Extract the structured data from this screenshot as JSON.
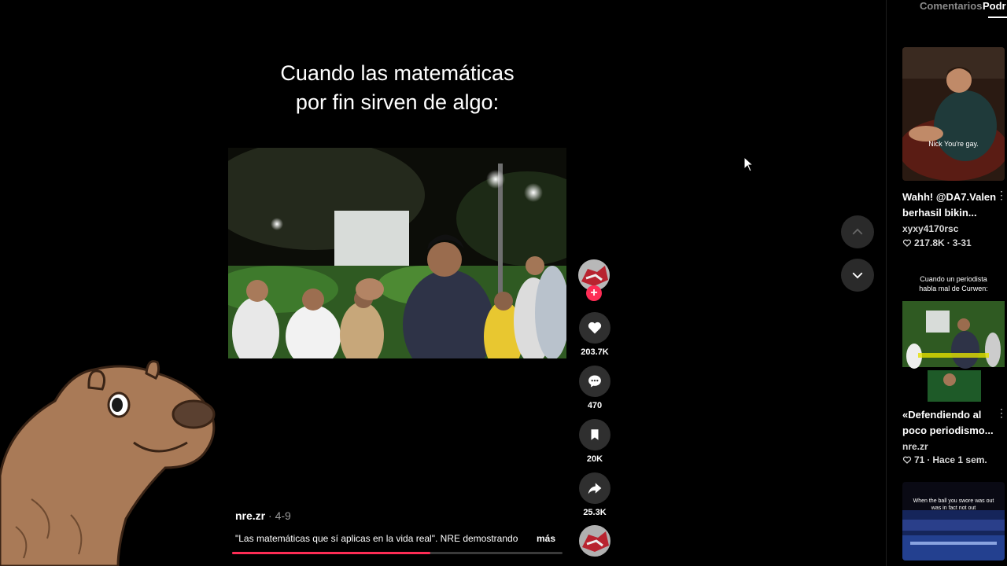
{
  "video": {
    "caption": "Cuando las matemáticas\npor fin sirven de algo:",
    "author": "nre.zr",
    "date": "· 4-9",
    "description": "\"Las matemáticas que sí aplicas en la vida real\". NRE demostrando",
    "more_label": "más",
    "progress": 0.6
  },
  "actions": {
    "likes": "203.7K",
    "comments": "470",
    "saves": "20K",
    "shares": "25.3K"
  },
  "panel": {
    "tabs": [
      "Comentarios",
      "Podr"
    ],
    "items": [
      {
        "title": "Wahh! @DA7.Valen berhasil bikin...",
        "author": "xyxy4170rsc",
        "likes": "217.8K",
        "time": "3-31",
        "thumb_subtitle": "Nick You're gay."
      },
      {
        "title": "«Defendiendo al poco periodismo...",
        "author": "nre.zr",
        "likes": "71",
        "time": "Hace 1 sem.",
        "thumb_heading": "Cuando un periodista habla mal de Curwen:"
      },
      {
        "thumb_heading": "When the ball you swore was out was in fact not out"
      }
    ]
  },
  "colors": {
    "accent": "#fe2c55",
    "background": "#000000",
    "button": "#2f2f2f"
  },
  "icons": [
    "heart-icon",
    "comment-icon",
    "bookmark-icon",
    "share-icon",
    "chevron-up-icon",
    "chevron-down-icon",
    "plus-icon",
    "cursor-icon"
  ]
}
